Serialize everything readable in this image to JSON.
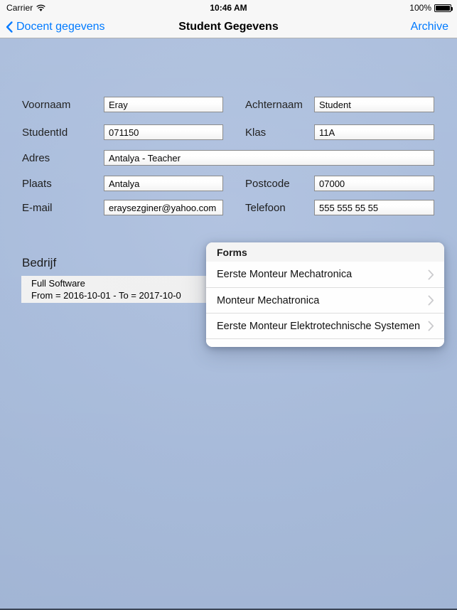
{
  "status_bar": {
    "carrier": "Carrier",
    "wifi_icon": "wifi-icon",
    "time": "10:46 AM",
    "battery_percent": "100%",
    "battery_icon": "battery-icon"
  },
  "nav_bar": {
    "back_icon": "chevron-left-icon",
    "back_label": "Docent gegevens",
    "title": "Student Gegevens",
    "right_action": "Archive",
    "tint_color": "#007aff"
  },
  "form": {
    "fields": [
      {
        "label": "Voornaam",
        "value": "Eray",
        "name": "voornaam"
      },
      {
        "label": "Achternaam",
        "value": "Student",
        "name": "achternaam"
      },
      {
        "label": "StudentId",
        "value": "071150",
        "name": "studentid"
      },
      {
        "label": "Klas",
        "value": "11A",
        "name": "klas"
      },
      {
        "label": "Adres",
        "value": "Antalya - Teacher",
        "name": "adres"
      },
      {
        "label": "Plaats",
        "value": "Antalya",
        "name": "plaats"
      },
      {
        "label": "Postcode",
        "value": "07000",
        "name": "postcode"
      },
      {
        "label": "E-mail",
        "value": "eraysezginer@yahoo.com",
        "name": "email"
      },
      {
        "label": "Telefoon",
        "value": "555 555 55 55",
        "name": "telefoon"
      }
    ]
  },
  "bedrijf": {
    "section_title": "Bedrijf",
    "cell": {
      "title": "Full Software",
      "subtitle": "From = 2016-10-01 - To = 2017-10-0"
    }
  },
  "popover": {
    "header_title": "Forms",
    "items": [
      {
        "label": "Eerste Monteur Mechatronica",
        "accessory": "chevron-right-icon"
      },
      {
        "label": "Monteur Mechatronica",
        "accessory": "chevron-right-icon"
      },
      {
        "label": "Eerste Monteur Elektrotechnische Systemen",
        "accessory": "chevron-right-icon"
      }
    ]
  },
  "colors": {
    "background": "#a9bcdc",
    "bar_background": "#f7f7f7",
    "tint": "#007aff",
    "field_border": "#8a8a8a"
  }
}
